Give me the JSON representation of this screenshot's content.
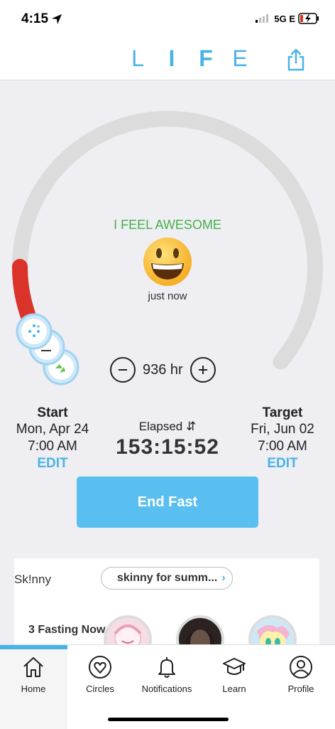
{
  "status_bar": {
    "time": "4:15",
    "network": "5G E"
  },
  "header": {
    "logo_letters": [
      "L",
      "I",
      "F",
      "E"
    ]
  },
  "feeling": {
    "title": "I FEEL AWESOME",
    "ago": "just now"
  },
  "goal": {
    "value": "936 hr"
  },
  "start": {
    "label": "Start",
    "date": "Mon, Apr 24",
    "time": "7:00 AM",
    "edit": "EDIT"
  },
  "elapsed": {
    "label": "Elapsed ⇵",
    "value": "153:15:52",
    "fraction": 0.164
  },
  "target": {
    "label": "Target",
    "date": "Fri, Jun 02",
    "time": "7:00 AM",
    "edit": "EDIT"
  },
  "end_button": "End Fast",
  "circle": {
    "name": "Sk!nny",
    "pill": "skinny for summ...",
    "pill_chevron": "›",
    "fasting_now": "3 Fasting Now",
    "arrow": "›"
  },
  "tabs": [
    {
      "label": "Home",
      "icon": "home-icon"
    },
    {
      "label": "Circles",
      "icon": "heart-circle-icon"
    },
    {
      "label": "Notifications",
      "icon": "bell-icon"
    },
    {
      "label": "Learn",
      "icon": "graduation-cap-icon"
    },
    {
      "label": "Profile",
      "icon": "person-icon"
    }
  ],
  "colors": {
    "accent": "#4ab3e6",
    "progress": "#d9332a",
    "feel": "#46b04b",
    "ring": "#dcdcdc"
  }
}
